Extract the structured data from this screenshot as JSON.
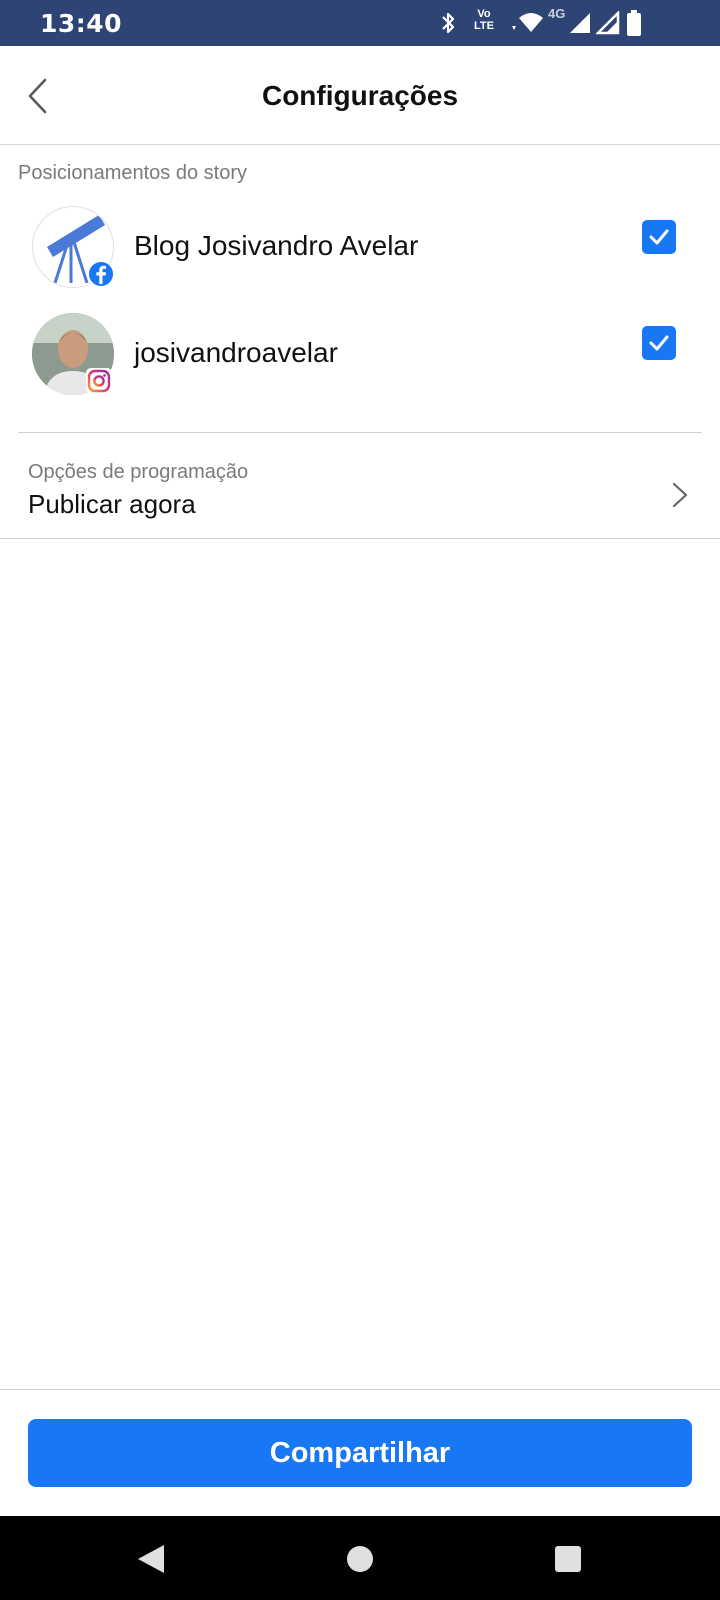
{
  "status_bar": {
    "time": "13:40",
    "volte_top": "Vo",
    "volte_bottom": "LTE",
    "network_type": "4G",
    "icons": [
      "bluetooth-icon",
      "volte-icon",
      "wifi-icon",
      "signal-icon",
      "signal-icon",
      "battery-icon"
    ]
  },
  "header": {
    "title": "Configurações",
    "back_icon": "chevron-left-icon"
  },
  "story_placements": {
    "section_label": "Posicionamentos do story",
    "accounts": [
      {
        "name": "Blog Josivandro Avelar",
        "platform": "facebook",
        "badge_icon": "facebook-icon",
        "checked": true
      },
      {
        "name": "josivandroavelar",
        "platform": "instagram",
        "badge_icon": "instagram-icon",
        "checked": true
      }
    ]
  },
  "schedule": {
    "label": "Opções de programação",
    "value": "Publicar agora",
    "icon": "chevron-right-icon"
  },
  "footer": {
    "share_label": "Compartilhar"
  },
  "colors": {
    "status_bar": "#2e4475",
    "accent": "#1877f2",
    "divider": "#d0d0d0",
    "secondary_text": "#7a7a7a"
  }
}
